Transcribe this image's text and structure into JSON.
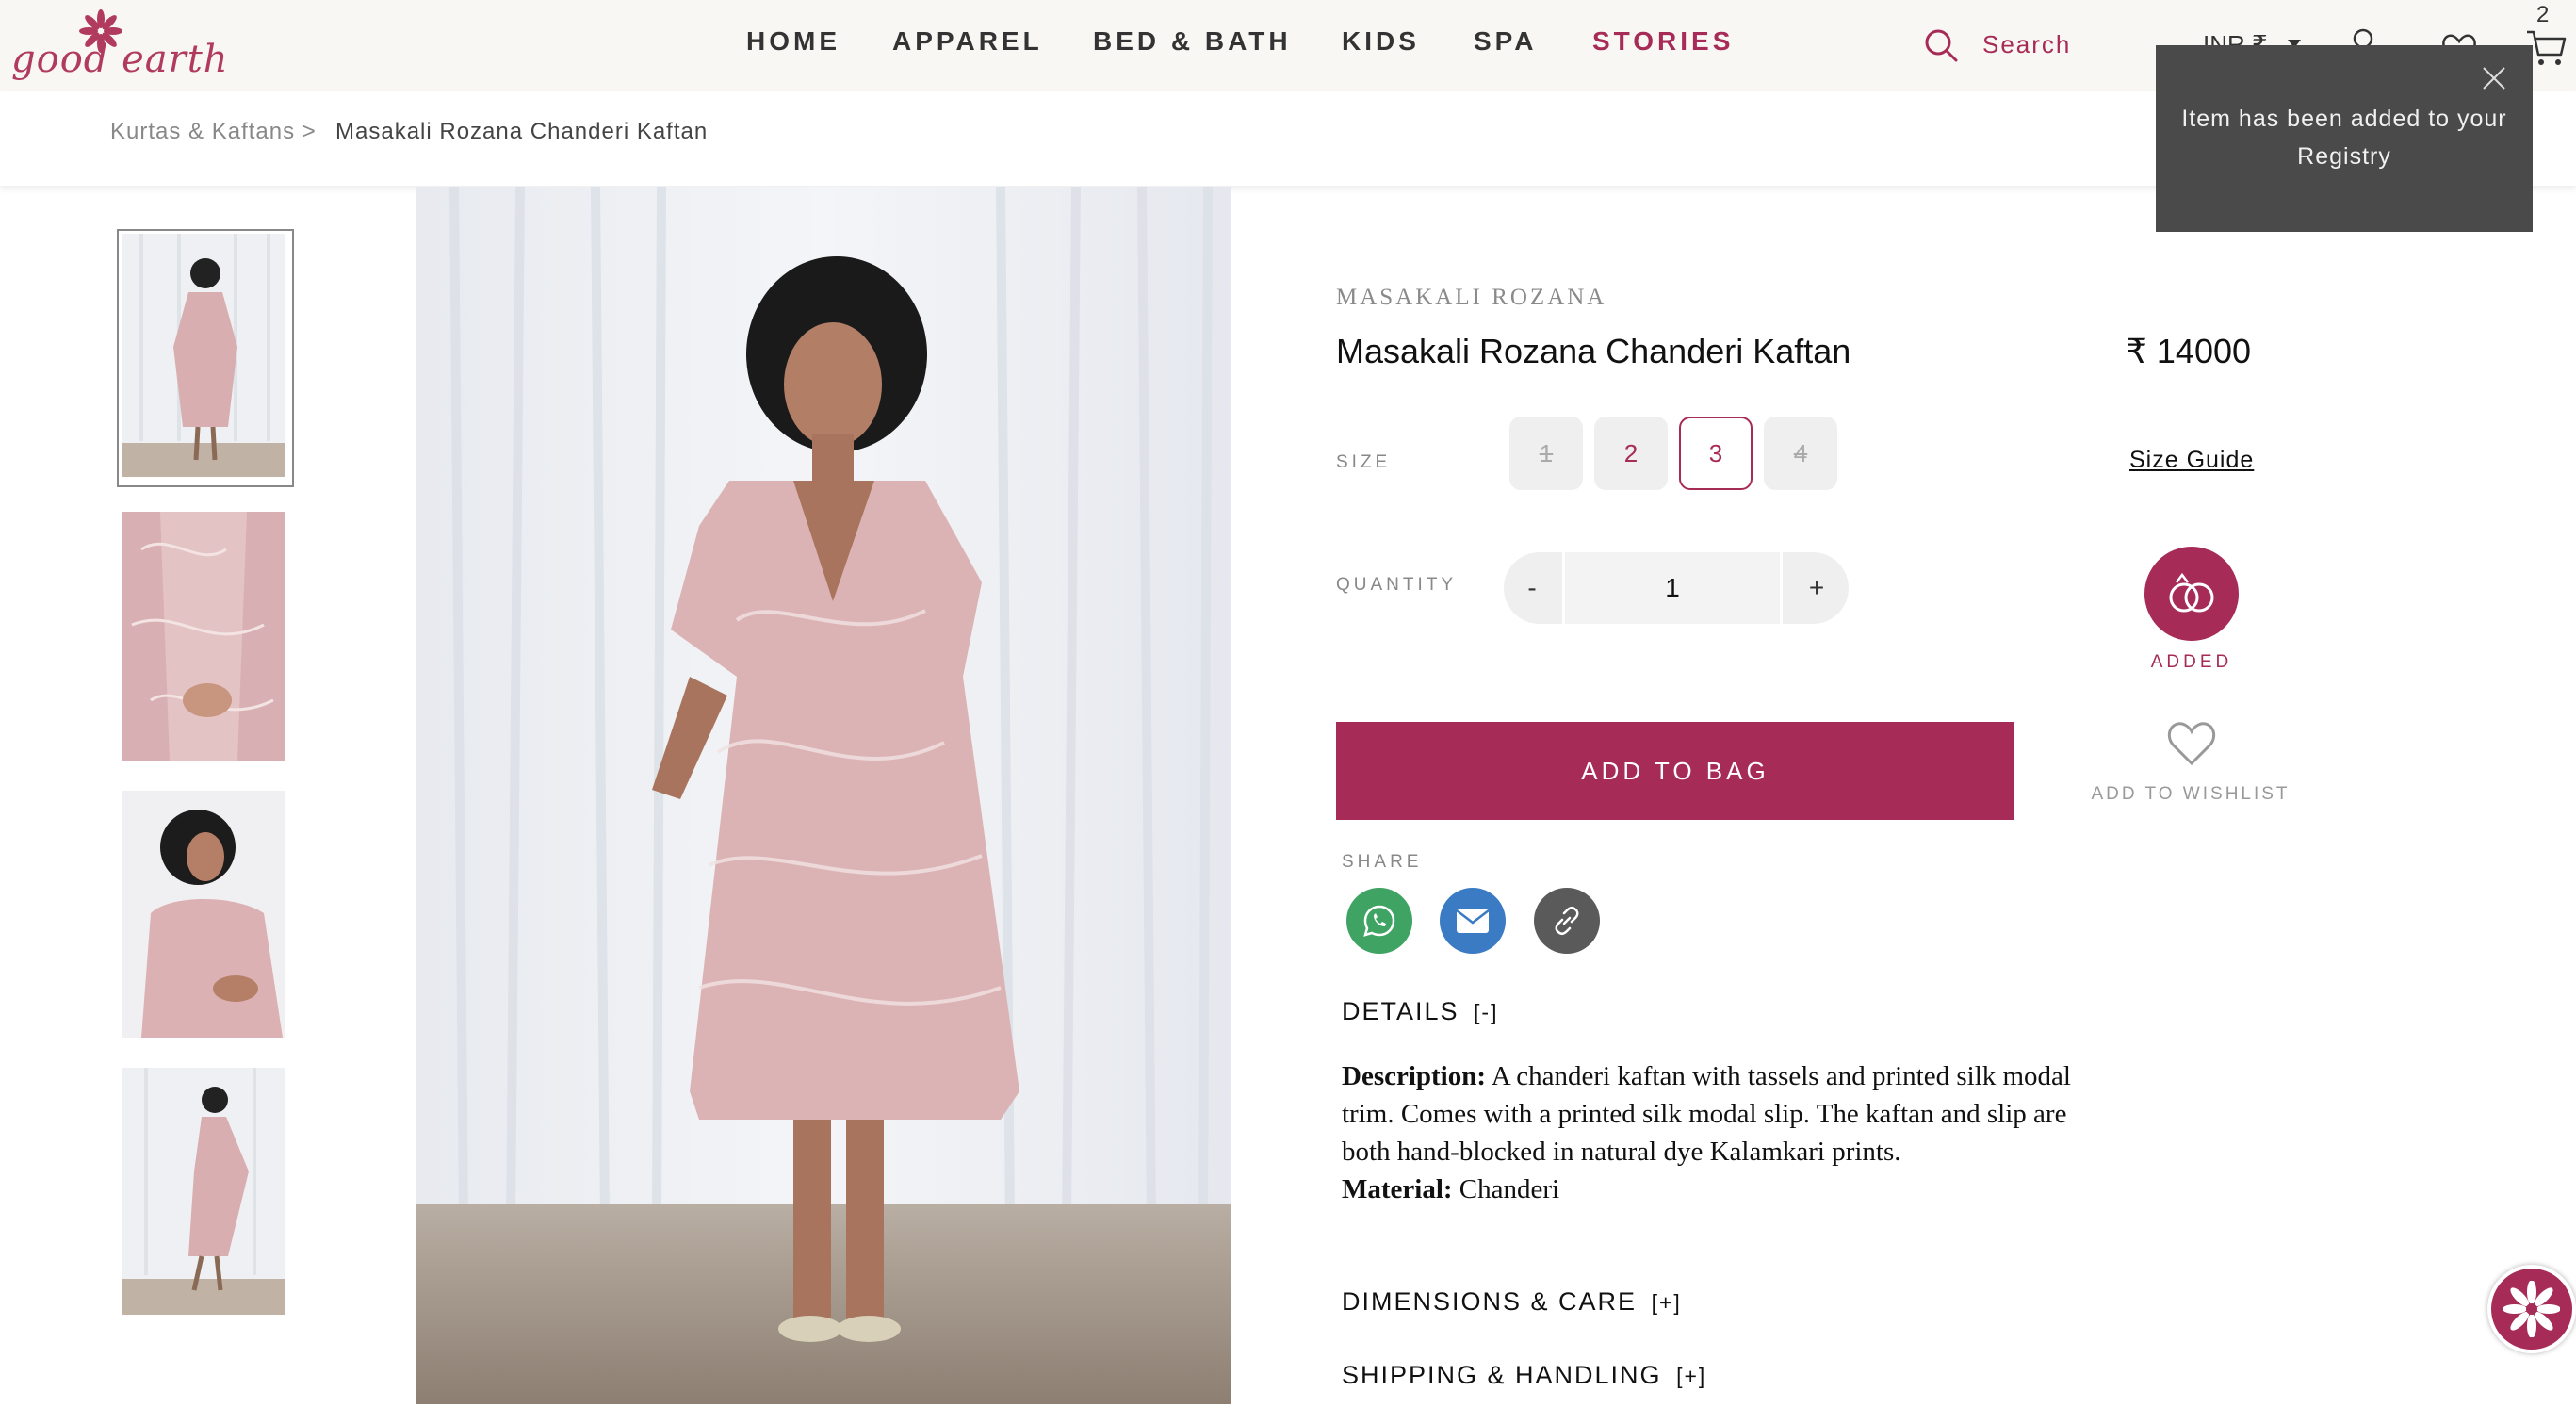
{
  "logo": {
    "text": "good earth"
  },
  "nav": {
    "items": [
      "HOME",
      "APPAREL",
      "BED & BATH",
      "KIDS",
      "SPA",
      "STORIES"
    ]
  },
  "header": {
    "search_label": "Search",
    "currency": "INR ₹",
    "cart_count": "2"
  },
  "breadcrumb": {
    "parent": "Kurtas & Kaftans >",
    "current": "Masakali Rozana Chanderi Kaftan"
  },
  "toast": {
    "message": "Item has been added to your Registry"
  },
  "product": {
    "brand": "MASAKALI ROZANA",
    "title": "Masakali Rozana Chanderi Kaftan",
    "price": "₹ 14000",
    "size_label": "SIZE",
    "sizes": [
      {
        "label": "1",
        "state": "unavailable"
      },
      {
        "label": "2",
        "state": "available"
      },
      {
        "label": "3",
        "state": "selected"
      },
      {
        "label": "4",
        "state": "unavailable"
      }
    ],
    "size_guide": "Size Guide",
    "quantity_label": "QUANTITY",
    "quantity_minus": "-",
    "quantity_value": "1",
    "quantity_plus": "+",
    "registry_label": "ADDED",
    "add_to_bag": "ADD TO BAG",
    "wishlist_label": "ADD TO WISHLIST",
    "share_label": "SHARE"
  },
  "details": {
    "heading": "DETAILS",
    "toggle": "[-]",
    "description_label": "Description:",
    "description": "A chanderi kaftan with tassels and printed silk modal trim. Comes with a printed silk modal slip. The kaftan and slip are both hand-blocked in natural dye Kalamkari prints.",
    "material_label": "Material:",
    "material": "Chanderi"
  },
  "dimensions": {
    "heading": "DIMENSIONS & CARE",
    "toggle": "[+]"
  },
  "shipping": {
    "heading": "SHIPPING & HANDLING",
    "toggle": "[+]"
  },
  "colors": {
    "brand": "#a72b57",
    "toast_bg": "#4a4a4a",
    "whatsapp": "#3fa363",
    "email": "#3a7bc4",
    "link": "#5a5a5a"
  },
  "icons": [
    "flower-logo-icon",
    "search-icon",
    "user-icon",
    "heart-icon",
    "cart-icon",
    "close-icon",
    "registry-rings-icon",
    "whatsapp-icon",
    "email-icon",
    "link-icon",
    "help-flower-icon"
  ]
}
